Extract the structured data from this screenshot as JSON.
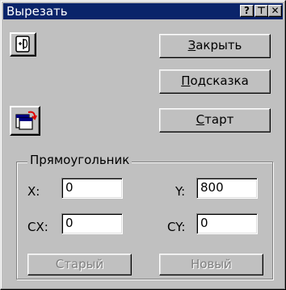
{
  "window": {
    "title": "Вырезать",
    "help_glyph": "?",
    "pin_glyph": "⊤",
    "close_glyph": "✕"
  },
  "buttons": {
    "close_label_u": "З",
    "close_label_rest": "акрыть",
    "hint_label_u": "П",
    "hint_label_rest": "одсказка",
    "start_label_u": "С",
    "start_label_rest": "тарт",
    "old_label": "Старый",
    "new_label": "Новый"
  },
  "rectangle": {
    "group_label": "Прямоугольник",
    "x_label": "X:",
    "x_value": "0",
    "y_label": "Y:",
    "y_value": "800",
    "cx_label": "CX:",
    "cx_value": "0",
    "cy_label": "CY:",
    "cy_value": "0"
  }
}
